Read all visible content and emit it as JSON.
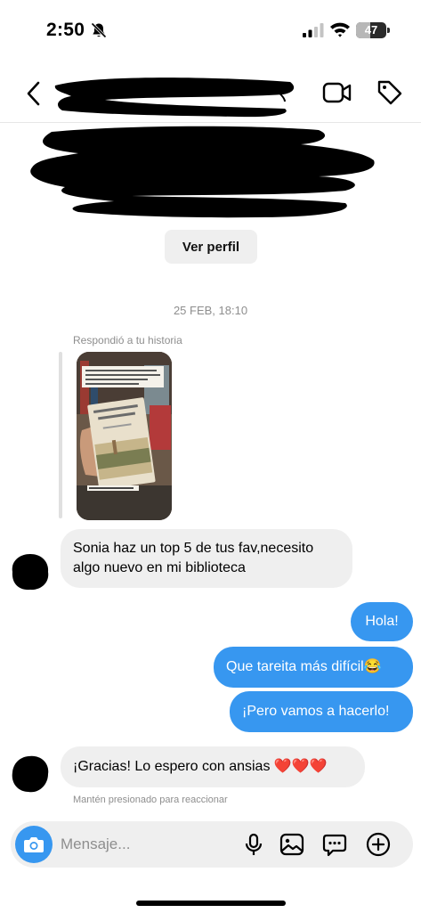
{
  "status_bar": {
    "time": "2:50",
    "battery": "47",
    "battery_level": 0.47,
    "icons": [
      "bell-slash-icon",
      "cellular-signal-icon",
      "wifi-icon",
      "battery-icon"
    ]
  },
  "header": {
    "icons": [
      "chevron-left-icon",
      "video-call-icon",
      "tag-icon"
    ]
  },
  "profile": {
    "view_profile_label": "Ver perfil"
  },
  "conversation": {
    "date": "25 FEB, 18:10",
    "story_reply_label": "Respondió a tu historia",
    "messages": [
      {
        "from": "them",
        "text": "Sonia haz un top 5 de tus fav,necesito algo nuevo en mi biblioteca"
      },
      {
        "from": "me",
        "text": "Hola!"
      },
      {
        "from": "me",
        "text": "Que tareita más difícil😂"
      },
      {
        "from": "me",
        "text": "¡Pero vamos a hacerlo!"
      },
      {
        "from": "them",
        "text": "¡Gracias! Lo espero con ansias ❤️❤️❤️"
      }
    ],
    "react_hint": "Mantén presionado para reaccionar"
  },
  "composer": {
    "placeholder": "Mensaje...",
    "icons": [
      "camera-icon",
      "microphone-icon",
      "gallery-icon",
      "sticker-icon",
      "plus-icon"
    ]
  },
  "colors": {
    "accent": "#3797f0",
    "incoming_bubble": "#efefef",
    "muted_text": "#8e8e8e"
  }
}
